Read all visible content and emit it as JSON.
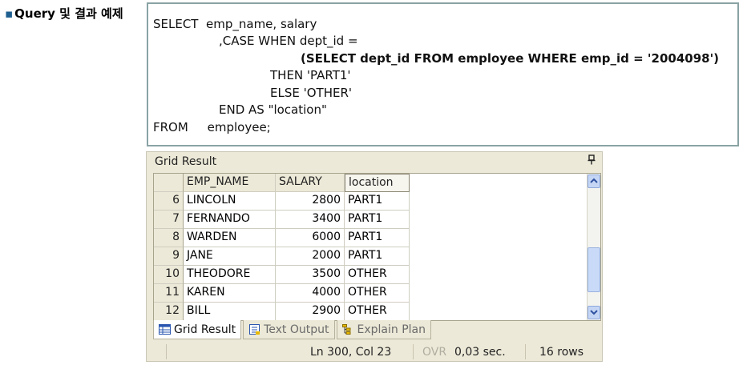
{
  "heading": {
    "bullet": "▪",
    "text": "Query 및 결과 예제"
  },
  "sql": {
    "l1": "SELECT  emp_name, salary",
    "l2": ",CASE WHEN dept_id =",
    "l3": "(SELECT dept_id FROM employee WHERE emp_id = '2004098')",
    "l4": "THEN 'PART1'",
    "l5": "ELSE 'OTHER'",
    "l6": "END AS \"location\"",
    "l7": "FROM     employee;"
  },
  "panel": {
    "title": "Grid Result",
    "pin": "ᵖ"
  },
  "grid": {
    "columns": [
      "EMP_NAME",
      "SALARY",
      "location"
    ],
    "rows": [
      {
        "num": "6",
        "name": "LINCOLN",
        "salary": "2800",
        "location": "PART1"
      },
      {
        "num": "7",
        "name": "FERNANDO",
        "salary": "3400",
        "location": "PART1"
      },
      {
        "num": "8",
        "name": "WARDEN",
        "salary": "6000",
        "location": "PART1"
      },
      {
        "num": "9",
        "name": "JANE",
        "salary": "2000",
        "location": "PART1"
      },
      {
        "num": "10",
        "name": "THEODORE",
        "salary": "3500",
        "location": "OTHER"
      },
      {
        "num": "11",
        "name": "KAREN",
        "salary": "4000",
        "location": "OTHER"
      },
      {
        "num": "12",
        "name": "BILL",
        "salary": "2900",
        "location": "OTHER"
      }
    ]
  },
  "tabs": [
    {
      "label": "Grid Result",
      "icon": "grid-icon",
      "active": true
    },
    {
      "label": "Text Output",
      "icon": "text-output-icon",
      "active": false
    },
    {
      "label": "Explain Plan",
      "icon": "explain-plan-icon",
      "active": false
    }
  ],
  "status": {
    "position": "Ln 300, Col 23",
    "ovr": "OVR",
    "time": "0,03 sec.",
    "rows": "16 rows"
  },
  "colors": {
    "sql_border": "#8aa3a4",
    "panel_bg": "#ece9d8",
    "scroll_accent": "#c5d6f5",
    "bullet": "#1f5f8f"
  }
}
